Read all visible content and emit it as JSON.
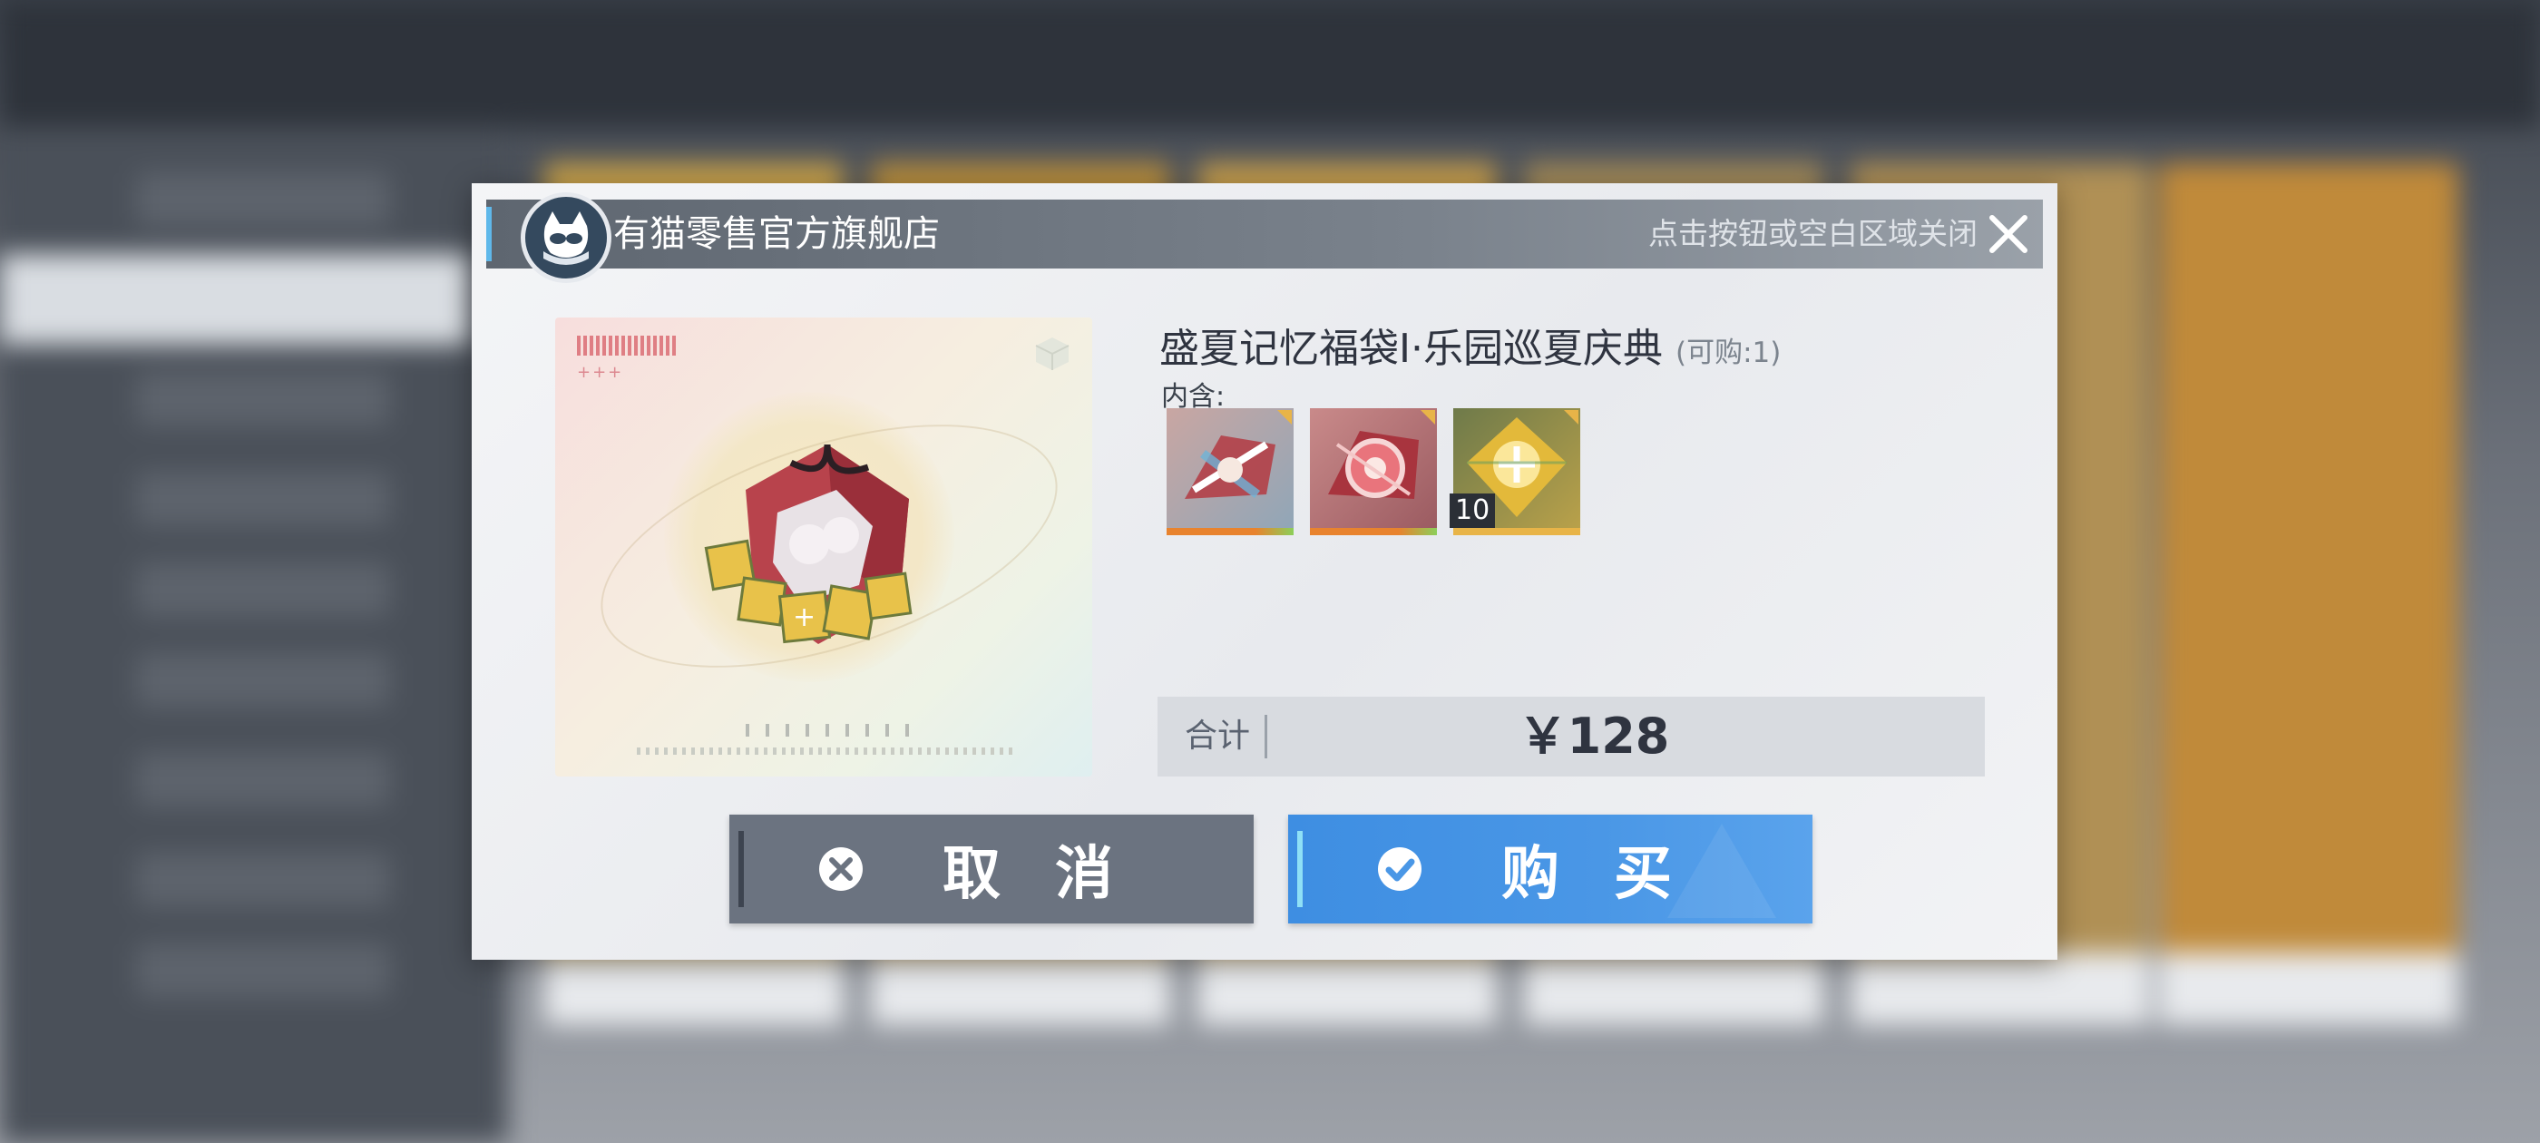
{
  "dialog": {
    "shop_name": "有猫零售官方旗舰店",
    "close_hint": "点击按钮或空白区域关闭"
  },
  "product": {
    "title": "盛夏记忆福袋Ⅰ·乐园巡夏庆典",
    "limit": "(可购:1)",
    "contains_label": "内含:",
    "items": [
      {
        "icon": "red-blue-shard-icon",
        "rarity_color": "#e8832e",
        "qty": ""
      },
      {
        "icon": "red-orb-shard-icon",
        "rarity_color": "#e8832e",
        "qty": ""
      },
      {
        "icon": "gold-star-shard-icon",
        "rarity_color": "#e8b448",
        "qty": "10"
      }
    ]
  },
  "total": {
    "label": "合计",
    "price": "￥128"
  },
  "buttons": {
    "cancel": "取消",
    "buy": "购买"
  },
  "colors": {
    "accent": "#5fb8ea",
    "buy_button": "#4a97e6",
    "cancel_button": "#6b7380"
  }
}
